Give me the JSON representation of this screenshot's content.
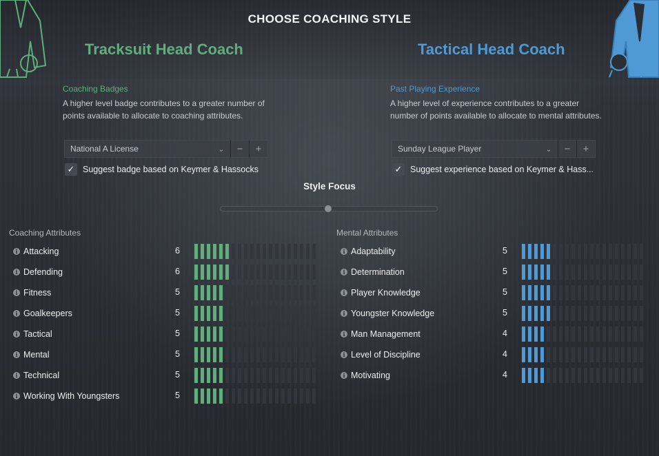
{
  "title": "CHOOSE COACHING STYLE",
  "left": {
    "coach_title": "Tracksuit Head Coach",
    "section_label": "Coaching Badges",
    "description": "A higher level badge contributes to a greater number of points available to allocate to coaching attributes.",
    "dropdown_value": "National A License",
    "suggest_label": "Suggest badge based on Keymer & Hassocks",
    "suggest_checked": true,
    "attributes_header": "Coaching Attributes",
    "bar_color": "#5fae7c",
    "attributes": [
      {
        "name": "Attacking",
        "value": 6
      },
      {
        "name": "Defending",
        "value": 6
      },
      {
        "name": "Fitness",
        "value": 5
      },
      {
        "name": "Goalkeepers",
        "value": 5
      },
      {
        "name": "Tactical",
        "value": 5
      },
      {
        "name": "Mental",
        "value": 5
      },
      {
        "name": "Technical",
        "value": 5
      },
      {
        "name": "Working With Youngsters",
        "value": 5
      }
    ]
  },
  "right": {
    "coach_title": "Tactical Head Coach",
    "section_label": "Past Playing Experience",
    "description": "A higher level of experience contributes to a greater number of points available to allocate to mental attributes.",
    "dropdown_value": "Sunday League Player",
    "suggest_label": "Suggest experience based on Keymer & Hass...",
    "suggest_checked": true,
    "attributes_header": "Mental Attributes",
    "bar_color": "#4f9ad4",
    "attributes": [
      {
        "name": "Adaptability",
        "value": 5
      },
      {
        "name": "Determination",
        "value": 5
      },
      {
        "name": "Player Knowledge",
        "value": 5
      },
      {
        "name": "Youngster Knowledge",
        "value": 5
      },
      {
        "name": "Man Management",
        "value": 4
      },
      {
        "name": "Level of Discipline",
        "value": 4
      },
      {
        "name": "Motivating",
        "value": 4
      }
    ]
  },
  "style_focus": {
    "label": "Style Focus",
    "position": 0.5
  },
  "bar_max": 20,
  "empty_bar_color": "#33373d",
  "icons": {
    "dropdown": "chevron-down-icon",
    "minus": "minus-icon",
    "plus": "plus-icon",
    "check": "check-icon",
    "info": "info-icon"
  }
}
